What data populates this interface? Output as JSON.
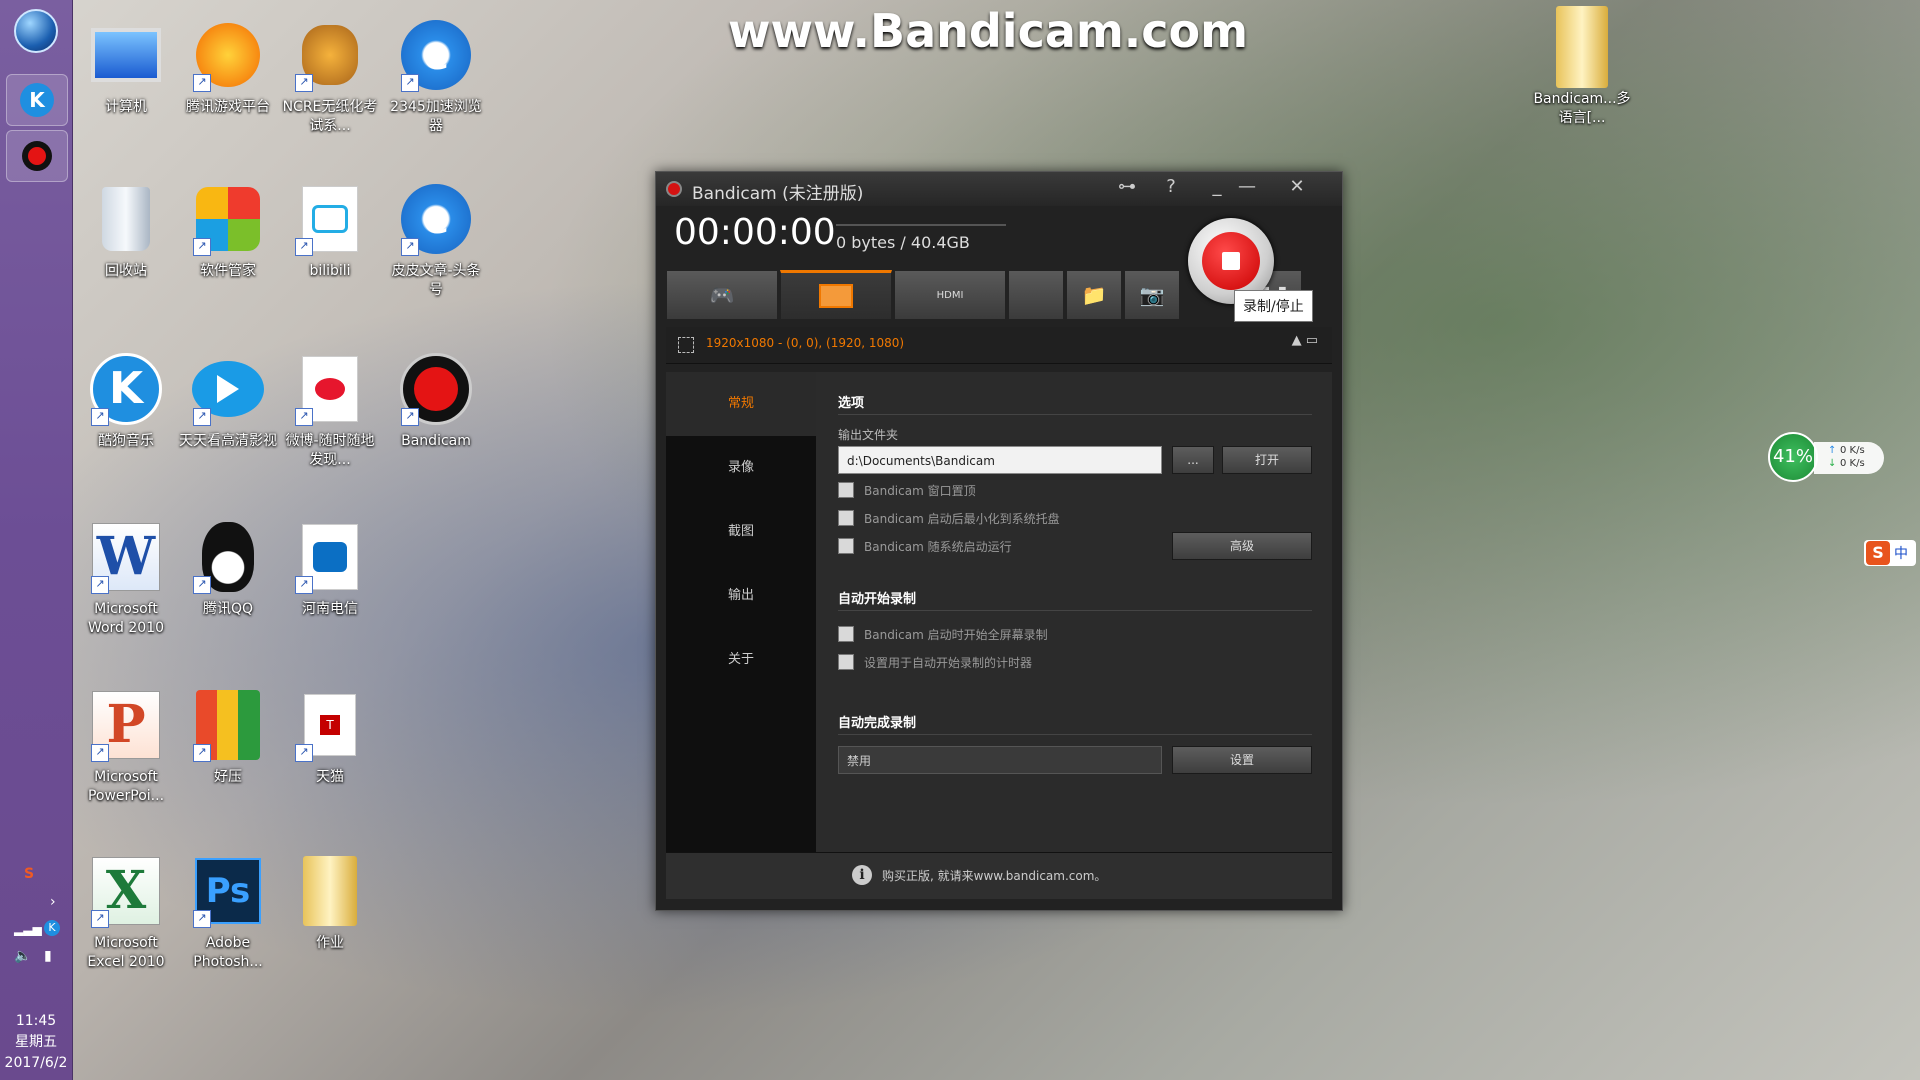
{
  "watermark": "www.Bandicam.com",
  "taskbar": {
    "clock_time": "11:45",
    "clock_day": "星期五",
    "clock_date": "2017/6/2"
  },
  "desktop_icons": [
    {
      "label": "计算机"
    },
    {
      "label": "腾讯游戏平台"
    },
    {
      "label": "NCRE无纸化考试系..."
    },
    {
      "label": "2345加速浏览器"
    },
    {
      "label": "回收站"
    },
    {
      "label": "软件管家"
    },
    {
      "label": "bilibili"
    },
    {
      "label": "皮皮文章-头条号"
    },
    {
      "label": "酷狗音乐"
    },
    {
      "label": "天天看高清影视"
    },
    {
      "label": "微博-随时随地发现..."
    },
    {
      "label": "Bandicam"
    },
    {
      "label": "Microsoft Word 2010"
    },
    {
      "label": "腾讯QQ"
    },
    {
      "label": "河南电信"
    },
    {
      "label": "Microsoft PowerPoi..."
    },
    {
      "label": "好压"
    },
    {
      "label": "天猫"
    },
    {
      "label": "Microsoft Excel 2010"
    },
    {
      "label": "Adobe Photosh..."
    },
    {
      "label": "作业"
    },
    {
      "label": "Bandicam...多语言[..."
    }
  ],
  "window": {
    "title": "Bandicam (未注册版)",
    "controls": {
      "key": "⊶",
      "help": "?",
      "min_small": "_",
      "minimize": "—",
      "close": "✕"
    },
    "timer": "00:00:00",
    "size": "0 bytes / 40.4GB",
    "record_tooltip": "录制/停止",
    "tabs": [
      {
        "label": "🎮",
        "name": "game"
      },
      {
        "label": "▭",
        "name": "screen"
      },
      {
        "label": "HDMI",
        "name": "hdmi"
      },
      {
        "label": "",
        "name": "blank"
      },
      {
        "label": "📁",
        "name": "folder"
      },
      {
        "label": "📷",
        "name": "camera"
      },
      {
        "label": "❚❚",
        "name": "pause"
      }
    ],
    "mode_text": "1920x1080 - (0, 0), (1920, 1080)",
    "mode_controls": "▲ ▭",
    "sidebar": [
      "常规",
      "录像",
      "截图",
      "输出",
      "关于"
    ],
    "content": {
      "options_title": "选项",
      "output_folder_label": "输出文件夹",
      "output_folder_value": "d:\\Documents\\Bandicam",
      "browse_btn": "...",
      "open_btn": "打开",
      "checkboxes": [
        "Bandicam 窗口置顶",
        "Bandicam 启动后最小化到系统托盘",
        "Bandicam 随系统启动运行"
      ],
      "advanced_btn": "高级",
      "auto_start_title": "自动开始录制",
      "auto_start_checks": [
        "Bandicam 启动时开始全屏幕录制",
        "设置用于自动开始录制的计时器"
      ],
      "auto_complete_title": "自动完成录制",
      "auto_complete_value": "禁用",
      "settings_btn": "设置"
    },
    "footer": "购买正版, 就请来www.bandicam.com。"
  },
  "net_widget": {
    "percent": "41%",
    "up": "0 K/s",
    "down": "0 K/s"
  },
  "ime": {
    "s": "S",
    "lang": "中"
  }
}
